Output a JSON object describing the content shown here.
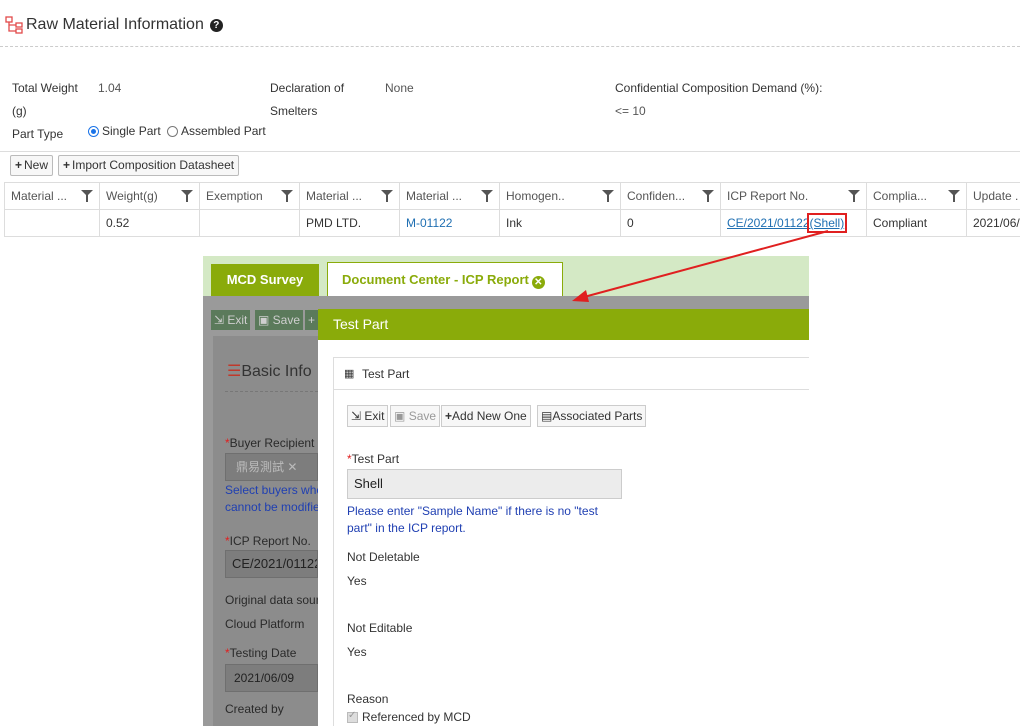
{
  "header": {
    "title": "Raw Material Information"
  },
  "info": {
    "total_weight_label": "Total Weight",
    "total_weight_unit": "(g)",
    "total_weight_value": "1.04",
    "declaration_label_1": "Declaration of",
    "declaration_label_2": "Smelters",
    "declaration_value": "None",
    "confidential_label": "Confidential Composition Demand (%):",
    "confidential_value": "<= 10",
    "part_type_label": "Part Type",
    "part_type_options": [
      "Single Part",
      "Assembled Part"
    ],
    "part_type_selected": "Single Part"
  },
  "toolbar": {
    "new_label": "New",
    "import_label": "Import Composition Datasheet"
  },
  "table": {
    "columns": [
      "Material ...",
      "Weight(g)",
      "Exemption",
      "Material ...",
      "Material ...",
      "Homogen..",
      "Confiden...",
      "ICP Report No.",
      "Complia...",
      "Update ."
    ],
    "row": {
      "material": "",
      "weight": "0.52",
      "exemption": "",
      "material_supplier": "PMD LTD.",
      "material_no": "M-01122",
      "homogeneous": "Ink",
      "confidential": "0",
      "icp_report": "CE/2021/01122",
      "icp_part": "(Shell)",
      "compliance": "Compliant",
      "update": "2021/06/"
    }
  },
  "colors": {
    "accent_green": "#8aab0a",
    "highlight_red": "#e02020",
    "link_blue": "#1f6fb2"
  },
  "popup": {
    "tabs": [
      "MCD Survey",
      "Document Center - ICP Report"
    ],
    "background": {
      "buttons": [
        "Exit",
        "Save"
      ],
      "section_title": "Basic Info",
      "buyer_label": "Buyer Recipient",
      "buyer_tag": "鼎易測試",
      "buyer_hint_1": "Select buyers whe",
      "buyer_hint_2": "cannot be modifie",
      "icp_label": "ICP Report No.",
      "icp_value": "CE/2021/01122",
      "original_label": "Original data sour",
      "original_value": "Cloud Platform",
      "testing_label": "Testing Date",
      "testing_value": "2021/06/09",
      "created_label": "Created by"
    },
    "modal": {
      "title": "Test Part",
      "card_title": "Test Part",
      "buttons": {
        "exit": "Exit",
        "save": "Save",
        "add": "Add New One",
        "assoc": "Associated Parts"
      },
      "field_label": "Test Part",
      "field_value": "Shell",
      "hint_1": "Please enter \"Sample Name\" if there is no \"test",
      "hint_2": "part\" in the ICP report.",
      "not_deletable_label": "Not Deletable",
      "not_deletable_value": "Yes",
      "not_editable_label": "Not Editable",
      "not_editable_value": "Yes",
      "reason_label": "Reason",
      "reason_value": "Referenced by MCD"
    }
  }
}
